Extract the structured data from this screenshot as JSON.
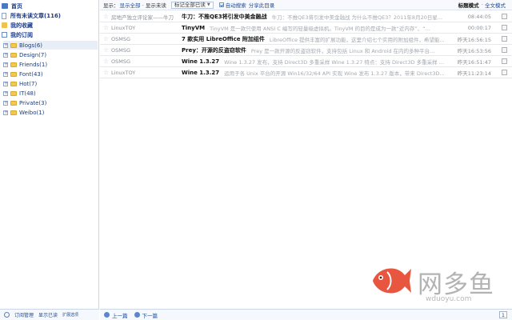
{
  "sidebar": {
    "top_items": [
      {
        "label": "首页",
        "icon": "home-icon"
      },
      {
        "label": "所有未读文章(116)",
        "icon": "document-icon"
      },
      {
        "label": "我的收藏",
        "icon": "favorite-icon"
      },
      {
        "label": "我的订阅",
        "icon": "feed-icon"
      }
    ],
    "folders": [
      {
        "label": "Blogs(6)"
      },
      {
        "label": "Design(7)"
      },
      {
        "label": "Friends(1)"
      },
      {
        "label": "Font(43)"
      },
      {
        "label": "Hot(7)"
      },
      {
        "label": "IT(48)"
      },
      {
        "label": "Private(3)"
      },
      {
        "label": "Weibo(1)"
      }
    ],
    "bottom": {
      "manage": "订阅管理",
      "show_read": "显示已读",
      "extra": "扩展选项"
    }
  },
  "toolbar": {
    "show_label": "显示：",
    "show_all": "显示全部",
    "sep": "-",
    "show_unread": "显示未读",
    "mark_all": "标记全部已读",
    "auto_search": "自动搜索",
    "share_dir": "分享此目录",
    "mode_title": "标题模式",
    "mode_full": "全文模式"
  },
  "articles": [
    {
      "source": "房地产独立评论家——牛刀",
      "title": "牛刀：不推QE3将引发中美金融战",
      "summary": "牛刀：不推QE3将引发中美金融战 为什么不推QE3？2011年8月20日星...",
      "time": "08:44:05"
    },
    {
      "source": "LinuxTOY",
      "title": "TinyVM",
      "summary": "TinyVM 是一款只使用 ANSI C 编写的轻量级虚拟机。TinyVM 的目的是成为一款“近内存”、“...",
      "time": "00:00:17"
    },
    {
      "source": "OSMSG",
      "title": "7 款实用 LibreOffice 附加组件",
      "summary": "LibreOffice 提供丰富的扩展功能，这里介绍七个实用的附加组件，希望能...",
      "time": "昨天16:56:15"
    },
    {
      "source": "OSMSG",
      "title": "Prey：开源的反盗窃软件",
      "summary": "Prey 是一款开源的反盗窃软件，支持包括 Linux 和 Android 在内的多种平台...",
      "time": "昨天16:53:56"
    },
    {
      "source": "OSMSG",
      "title": "Wine 1.3.27",
      "summary": "Wine 1.3.27 发布，支持 Direct3D 多重采样 Wine 1.3.27 特点：支持 Direct3D 多重采样 最新...",
      "time": "昨天16:51:47"
    },
    {
      "source": "LinuxTOY",
      "title": "Wine 1.3.27",
      "summary": "运用于各 Unix 平台的开源 Win16/32/64 API 实现 Wine 发布 1.3.27 版本，带来 Direct3D...",
      "time": "昨天11:23:14"
    }
  ],
  "pager": {
    "prev": "上一篇",
    "next": "下一篇",
    "page": "1"
  },
  "watermark": {
    "brand": "网多鱼",
    "url": "wduoyu.com"
  },
  "colors": {
    "accent": "#1f4c97",
    "selected_bg": "#e7eef8",
    "folder": "#f3c851",
    "fish": "#e8563f"
  }
}
